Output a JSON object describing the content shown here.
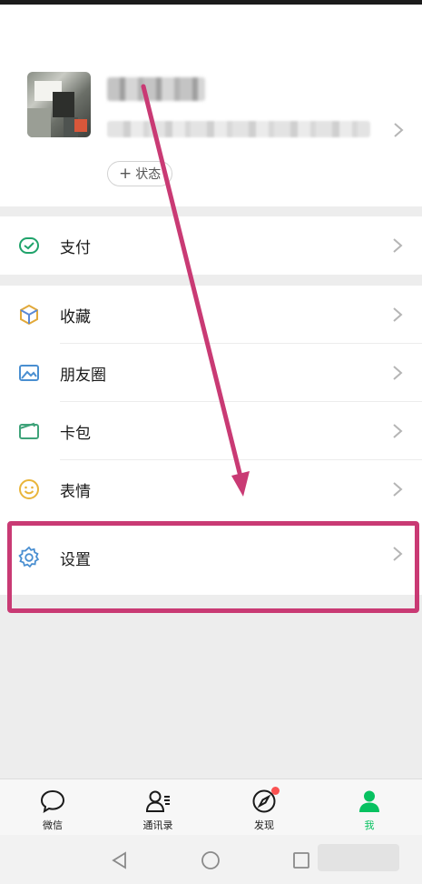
{
  "profile": {
    "status_label": "状态"
  },
  "menu": {
    "pay": "支付",
    "favorites": "收藏",
    "moments": "朋友圈",
    "cards": "卡包",
    "stickers": "表情",
    "settings": "设置"
  },
  "tabs": {
    "chats": "微信",
    "contacts": "通讯录",
    "discover": "发现",
    "me": "我"
  },
  "colors": {
    "accent": "#07c160",
    "annotation": "#c93a74",
    "badge": "#fa5151"
  }
}
